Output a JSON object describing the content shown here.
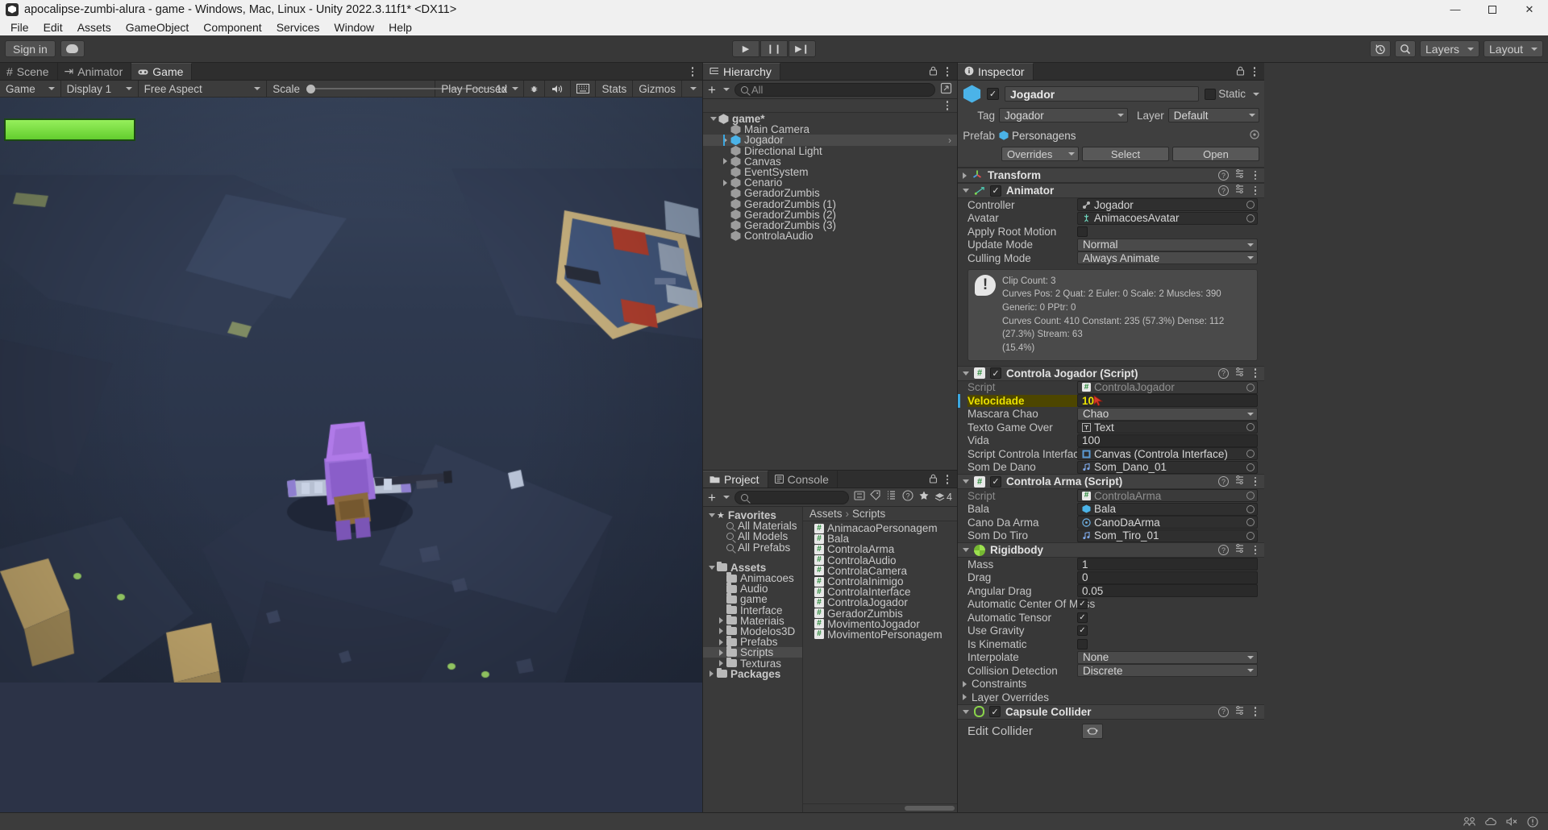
{
  "window": {
    "title": "apocalipse-zumbi-alura - game - Windows, Mac, Linux - Unity 2022.3.11f1* <DX11>",
    "minimize": "—",
    "maximize": "⬜",
    "close": "✕"
  },
  "menubar": [
    "File",
    "Edit",
    "Assets",
    "GameObject",
    "Component",
    "Services",
    "Window",
    "Help"
  ],
  "toolbar": {
    "signin": "Sign in",
    "cloud_icon": "cloud-icon",
    "play": "▶",
    "pause": "❙❙",
    "step": "▶❙",
    "history_icon": "history-icon",
    "search_icon": "search-icon",
    "layers": "Layers",
    "layout": "Layout"
  },
  "game_panel": {
    "tabs": [
      {
        "label": "Scene",
        "icon": "grid-icon",
        "active": false
      },
      {
        "label": "Animator",
        "icon": "animator-icon",
        "active": false
      },
      {
        "label": "Game",
        "icon": "gamepad-icon",
        "active": true
      }
    ],
    "toolbar": {
      "view": "Game",
      "display": "Display 1",
      "aspect": "Free Aspect",
      "scale_label": "Scale",
      "scale_value": "1x",
      "play_mode": "Play Focused",
      "mute_icon": "mute-audio-icon",
      "stats_toggle_icon": "frame-debug-icon",
      "stats": "Stats",
      "gizmos": "Gizmos",
      "bug_icon": "bug-icon"
    },
    "hud": {
      "health_bar": "player-health-bar"
    }
  },
  "hierarchy": {
    "tab": "Hierarchy",
    "create_label": "+",
    "search_placeholder": "All",
    "items": [
      {
        "label": "game*",
        "depth": 0,
        "expand": "down",
        "icon": "unity-scene-icon",
        "selected": false
      },
      {
        "label": "Main Camera",
        "depth": 1,
        "expand": "none",
        "icon": "cube-icon",
        "selected": false
      },
      {
        "label": "Jogador",
        "depth": 1,
        "expand": "right",
        "icon": "prefab-cube-icon",
        "selected": true
      },
      {
        "label": "Directional Light",
        "depth": 1,
        "expand": "none",
        "icon": "cube-icon",
        "selected": false
      },
      {
        "label": "Canvas",
        "depth": 1,
        "expand": "right",
        "icon": "cube-icon",
        "selected": false
      },
      {
        "label": "EventSystem",
        "depth": 1,
        "expand": "none",
        "icon": "cube-icon",
        "selected": false
      },
      {
        "label": "Cenario",
        "depth": 1,
        "expand": "right",
        "icon": "cube-icon",
        "selected": false
      },
      {
        "label": "GeradorZumbis",
        "depth": 1,
        "expand": "none",
        "icon": "cube-icon",
        "selected": false
      },
      {
        "label": "GeradorZumbis (1)",
        "depth": 1,
        "expand": "none",
        "icon": "cube-icon",
        "selected": false
      },
      {
        "label": "GeradorZumbis (2)",
        "depth": 1,
        "expand": "none",
        "icon": "cube-icon",
        "selected": false
      },
      {
        "label": "GeradorZumbis (3)",
        "depth": 1,
        "expand": "none",
        "icon": "cube-icon",
        "selected": false
      },
      {
        "label": "ControlaAudio",
        "depth": 1,
        "expand": "none",
        "icon": "cube-icon",
        "selected": false
      }
    ]
  },
  "project": {
    "tabs": [
      {
        "label": "Project",
        "icon": "folder-icon",
        "active": true
      },
      {
        "label": "Console",
        "icon": "console-icon",
        "active": false
      }
    ],
    "create_label": "+",
    "search_placeholder": "",
    "badge_count": "4",
    "tree": [
      {
        "label": "Favorites",
        "type": "star",
        "depth": 0,
        "expand": "down"
      },
      {
        "label": "All Materials",
        "type": "search",
        "depth": 1,
        "expand": "none"
      },
      {
        "label": "All Models",
        "type": "search",
        "depth": 1,
        "expand": "none"
      },
      {
        "label": "All Prefabs",
        "type": "search",
        "depth": 1,
        "expand": "none"
      },
      {
        "label": "",
        "type": "spacer",
        "depth": 0,
        "expand": "none"
      },
      {
        "label": "Assets",
        "type": "folder",
        "depth": 0,
        "expand": "down"
      },
      {
        "label": "Animacoes",
        "type": "folder",
        "depth": 1,
        "expand": "none"
      },
      {
        "label": "Audio",
        "type": "folder",
        "depth": 1,
        "expand": "none"
      },
      {
        "label": "game",
        "type": "folder",
        "depth": 1,
        "expand": "none"
      },
      {
        "label": "Interface",
        "type": "folder",
        "depth": 1,
        "expand": "none"
      },
      {
        "label": "Materiais",
        "type": "folder",
        "depth": 1,
        "expand": "right"
      },
      {
        "label": "Modelos3D",
        "type": "folder",
        "depth": 1,
        "expand": "right"
      },
      {
        "label": "Prefabs",
        "type": "folder",
        "depth": 1,
        "expand": "right"
      },
      {
        "label": "Scripts",
        "type": "folder",
        "depth": 1,
        "expand": "right",
        "selected": true
      },
      {
        "label": "Texturas",
        "type": "folder",
        "depth": 1,
        "expand": "right"
      },
      {
        "label": "Packages",
        "type": "folder",
        "depth": 0,
        "expand": "right"
      }
    ],
    "breadcrumb": [
      "Assets",
      "Scripts"
    ],
    "assets": [
      "AnimacaoPersonagem",
      "Bala",
      "ControlaArma",
      "ControlaAudio",
      "ControlaCamera",
      "ControlaInimigo",
      "ControlaInterface",
      "ControlaJogador",
      "GeradorZumbis",
      "MovimentoJogador",
      "MovimentoPersonagem"
    ]
  },
  "inspector": {
    "tab": "Inspector",
    "object_name": "Jogador",
    "enabled": true,
    "static_label": "Static",
    "tag_label": "Tag",
    "tag_value": "Jogador",
    "layer_label": "Layer",
    "layer_value": "Default",
    "prefab_label": "Prefab",
    "prefab_value": "Personagens",
    "overrides_label": "Overrides",
    "select_label": "Select",
    "open_label": "Open",
    "components": [
      {
        "name": "Transform",
        "icon": "transform-axis-icon",
        "expanded": false,
        "has_checkbox": false,
        "fields": []
      },
      {
        "name": "Animator",
        "icon": "animator-icon",
        "expanded": true,
        "has_checkbox": true,
        "checked": true,
        "fields": [
          {
            "label": "Controller",
            "type": "object",
            "value": "Jogador",
            "icon": "animator-controller-icon"
          },
          {
            "label": "Avatar",
            "type": "object",
            "value": "AnimacoesAvatar",
            "icon": "avatar-icon"
          },
          {
            "label": "Apply Root Motion",
            "type": "checkbox",
            "checked": false
          },
          {
            "label": "Update Mode",
            "type": "dropdown",
            "value": "Normal"
          },
          {
            "label": "Culling Mode",
            "type": "dropdown",
            "value": "Always Animate"
          }
        ],
        "info": {
          "icon": "warning-icon",
          "lines": [
            "Clip Count: 3",
            "Curves Pos: 2 Quat: 2 Euler: 0 Scale: 2 Muscles: 390 Generic: 0 PPtr: 0",
            "Curves Count: 410 Constant: 235 (57.3%) Dense: 112 (27.3%) Stream: 63",
            "(15.4%)"
          ]
        }
      },
      {
        "name": "Controla Jogador (Script)",
        "icon": "script-icon",
        "expanded": true,
        "has_checkbox": true,
        "checked": true,
        "fields": [
          {
            "label": "Script",
            "type": "object",
            "value": "ControlaJogador",
            "dim": true,
            "icon": "script-icon"
          },
          {
            "label": "Velocidade",
            "type": "number",
            "value": "10",
            "modified": true,
            "highlight": true
          },
          {
            "label": "Mascara Chao",
            "type": "dropdown",
            "value": "Chao"
          },
          {
            "label": "Texto Game Over",
            "type": "object",
            "value": "Text",
            "icon": "text-icon"
          },
          {
            "label": "Vida",
            "type": "number",
            "value": "100"
          },
          {
            "label": "Script Controla Interface",
            "type": "object",
            "value": "Canvas (Controla Interface)",
            "icon": "canvas-icon"
          },
          {
            "label": "Som De Dano",
            "type": "object",
            "value": "Som_Dano_01",
            "icon": "audio-icon"
          }
        ]
      },
      {
        "name": "Controla Arma (Script)",
        "icon": "script-icon",
        "expanded": true,
        "has_checkbox": true,
        "checked": true,
        "fields": [
          {
            "label": "Script",
            "type": "object",
            "value": "ControlaArma",
            "dim": true,
            "icon": "script-icon"
          },
          {
            "label": "Bala",
            "type": "object",
            "value": "Bala",
            "icon": "prefab-icon"
          },
          {
            "label": "Cano Da Arma",
            "type": "object",
            "value": "CanoDaArma",
            "icon": "transform-icon"
          },
          {
            "label": "Som Do Tiro",
            "type": "object",
            "value": "Som_Tiro_01",
            "icon": "audio-icon"
          }
        ]
      },
      {
        "name": "Rigidbody",
        "icon": "rigidbody-icon",
        "expanded": true,
        "has_checkbox": false,
        "fields": [
          {
            "label": "Mass",
            "type": "number",
            "value": "1"
          },
          {
            "label": "Drag",
            "type": "number",
            "value": "0"
          },
          {
            "label": "Angular Drag",
            "type": "number",
            "value": "0.05"
          },
          {
            "label": "Automatic Center Of Mass",
            "type": "checkbox",
            "checked": true
          },
          {
            "label": "Automatic Tensor",
            "type": "checkbox",
            "checked": true
          },
          {
            "label": "Use Gravity",
            "type": "checkbox",
            "checked": true
          },
          {
            "label": "Is Kinematic",
            "type": "checkbox",
            "checked": false
          },
          {
            "label": "Interpolate",
            "type": "dropdown",
            "value": "None"
          },
          {
            "label": "Collision Detection",
            "type": "dropdown",
            "value": "Discrete"
          },
          {
            "label": "Constraints",
            "type": "foldout"
          },
          {
            "label": "Layer Overrides",
            "type": "foldout"
          }
        ]
      },
      {
        "name": "Capsule Collider",
        "icon": "capsule-collider-icon",
        "expanded": true,
        "has_checkbox": true,
        "checked": true,
        "fields": [
          {
            "label": "Edit Collider",
            "type": "edit-collider"
          }
        ]
      }
    ]
  },
  "statusbar": {
    "icons": [
      "collab-icon",
      "cloud-icon",
      "mute-icon",
      "notification-icon"
    ]
  }
}
